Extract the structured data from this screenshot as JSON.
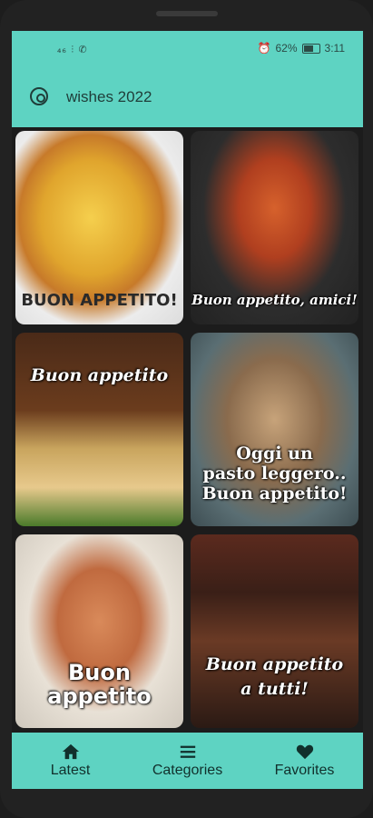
{
  "status_bar": {
    "signal": "₄₆ ⫶ ✆",
    "battery": "62%",
    "time": "3:11"
  },
  "app_bar": {
    "title": "wishes 2022"
  },
  "tiles": [
    {
      "caption": "BUON APPETITO!"
    },
    {
      "caption": "Buon appetito, amici!"
    },
    {
      "caption": "Buon appetito"
    },
    {
      "caption_line1": "Oggi un",
      "caption_line2": "pasto leggero..",
      "caption_line3": "Buon appetito!"
    },
    {
      "caption_line1": "Buon",
      "caption_line2": "appetito"
    },
    {
      "caption_line1": "Buon appetito",
      "caption_line2": "a tutti!"
    }
  ],
  "bottom_nav": [
    {
      "label": "Latest",
      "icon": "home-icon"
    },
    {
      "label": "Categories",
      "icon": "menu-icon"
    },
    {
      "label": "Favorites",
      "icon": "heart-icon"
    }
  ],
  "colors": {
    "accent": "#5ed3c2",
    "text_dark": "#1f3d39"
  }
}
